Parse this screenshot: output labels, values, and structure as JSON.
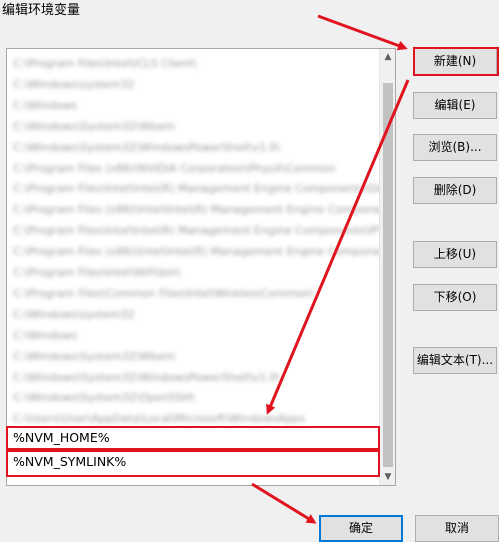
{
  "window": {
    "title": "编辑环境变量"
  },
  "path_list": {
    "items": [
      {
        "text": "C:\\Program Files\\Intel\\iCLS Client\\",
        "blurred": true
      },
      {
        "text": "C:\\Windows\\system32",
        "blurred": true
      },
      {
        "text": "C:\\Windows",
        "blurred": true
      },
      {
        "text": "C:\\Windows\\System32\\Wbem",
        "blurred": true
      },
      {
        "text": "C:\\Windows\\System32\\WindowsPowerShell\\v1.0\\",
        "blurred": true
      },
      {
        "text": "C:\\Program Files (x86)\\NVIDIA Corporation\\PhysX\\Common",
        "blurred": true
      },
      {
        "text": "C:\\Program Files\\Intel\\Intel(R) Management Engine Components\\DAL",
        "blurred": true
      },
      {
        "text": "C:\\Program Files (x86)\\Intel\\Intel(R) Management Engine Components\\DAL",
        "blurred": true
      },
      {
        "text": "C:\\Program Files\\Intel\\Intel(R) Management Engine Components\\IPT",
        "blurred": true
      },
      {
        "text": "C:\\Program Files (x86)\\Intel\\Intel(R) Management Engine Components\\IPT",
        "blurred": true
      },
      {
        "text": "C:\\Program Files\\Intel\\WiFi\\bin\\",
        "blurred": true
      },
      {
        "text": "C:\\Program Files\\Common Files\\Intel\\WirelessCommon\\",
        "blurred": true
      },
      {
        "text": "C:\\Windows\\system32",
        "blurred": true
      },
      {
        "text": "C:\\Windows",
        "blurred": true
      },
      {
        "text": "C:\\Windows\\System32\\Wbem",
        "blurred": true
      },
      {
        "text": "C:\\Windows\\System32\\WindowsPowerShell\\v1.0\\",
        "blurred": true
      },
      {
        "text": "C:\\Windows\\System32\\OpenSSH\\",
        "blurred": true
      },
      {
        "text": "C:\\Users\\User\\AppData\\Local\\Microsoft\\WindowsApps",
        "blurred": true
      },
      {
        "text": "%NVM_HOME%",
        "blurred": false
      },
      {
        "text": "%NVM_SYMLINK%",
        "blurred": false
      }
    ]
  },
  "buttons": {
    "new": "新建(N)",
    "edit": "编辑(E)",
    "browse": "浏览(B)...",
    "delete": "删除(D)",
    "move_up": "上移(U)",
    "move_down": "下移(O)",
    "edit_text": "编辑文本(T)...",
    "ok": "确定",
    "cancel": "取消"
  },
  "scrollbar": {
    "up_icon": "chevron-up-icon",
    "down_icon": "chevron-down-icon"
  },
  "colors": {
    "highlight_red": "#e0141e",
    "focus_blue": "#0078d7"
  }
}
